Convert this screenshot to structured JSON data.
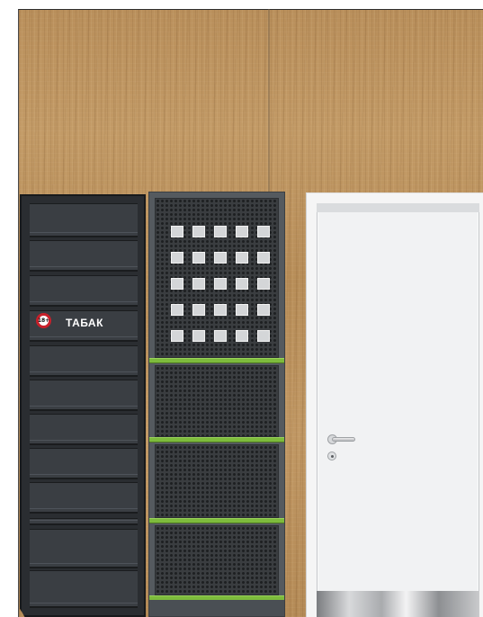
{
  "scene": {
    "sign": {
      "age_badge": "18+",
      "label": "ТАБАК"
    },
    "colors": {
      "cabinet": "#2a2d31",
      "shelf_accent": "#7dbb3c",
      "age_badge_ring": "#c8202a",
      "door": "#f1f2f3",
      "wall": "#c09763"
    }
  }
}
